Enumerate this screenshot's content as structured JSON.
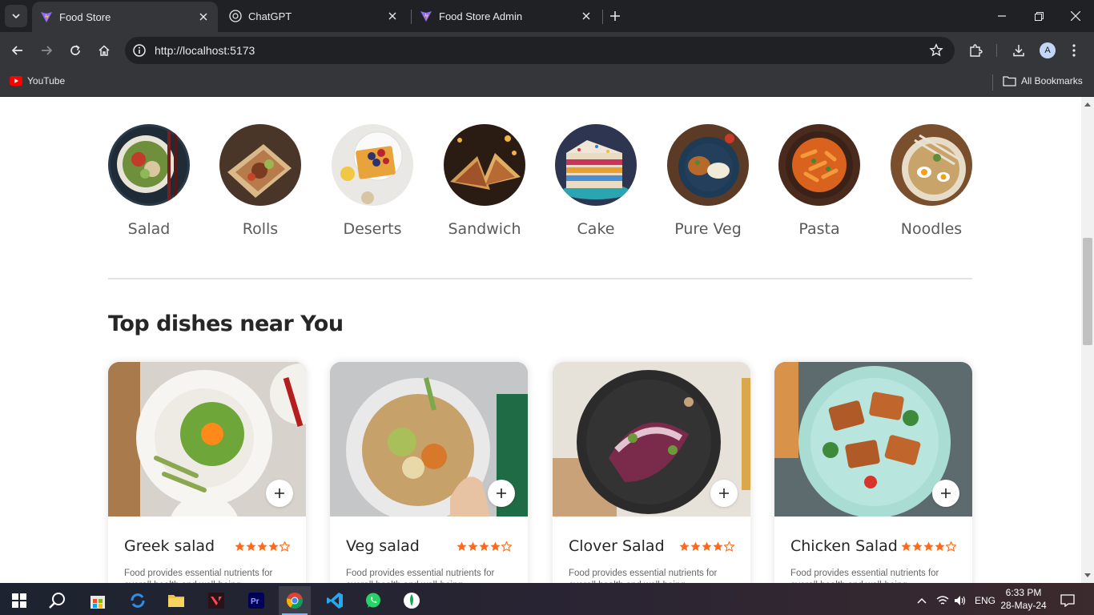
{
  "browser": {
    "tabs": [
      {
        "title": "Food Store",
        "active": true,
        "icon": "vite-icon"
      },
      {
        "title": "ChatGPT",
        "active": false,
        "icon": "chatgpt-icon"
      },
      {
        "title": "Food Store Admin",
        "active": false,
        "icon": "vite-icon"
      }
    ],
    "url": "http://localhost:5173",
    "profile_initial": "A",
    "bookmarks": [
      {
        "label": "YouTube",
        "icon": "youtube-icon"
      }
    ],
    "all_bookmarks_label": "All Bookmarks"
  },
  "page": {
    "categories": [
      {
        "name": "Salad"
      },
      {
        "name": "Rolls"
      },
      {
        "name": "Deserts"
      },
      {
        "name": "Sandwich"
      },
      {
        "name": "Cake"
      },
      {
        "name": "Pure Veg"
      },
      {
        "name": "Pasta"
      },
      {
        "name": "Noodles"
      }
    ],
    "section_title": "Top dishes near You",
    "dishes": [
      {
        "name": "Greek salad",
        "rating": 4,
        "description": "Food provides essential nutrients for overall health and well-being"
      },
      {
        "name": "Veg salad",
        "rating": 4,
        "description": "Food provides essential nutrients for overall health and well-being"
      },
      {
        "name": "Clover Salad",
        "rating": 4,
        "description": "Food provides essential nutrients for overall health and well-being"
      },
      {
        "name": "Chicken Salad",
        "rating": 4,
        "description": "Food provides essential nutrients for overall health and well-being"
      }
    ],
    "accent_color": "#ff6a1a"
  },
  "taskbar": {
    "language": "ENG",
    "time": "6:33 PM",
    "date": "28-May-24"
  }
}
